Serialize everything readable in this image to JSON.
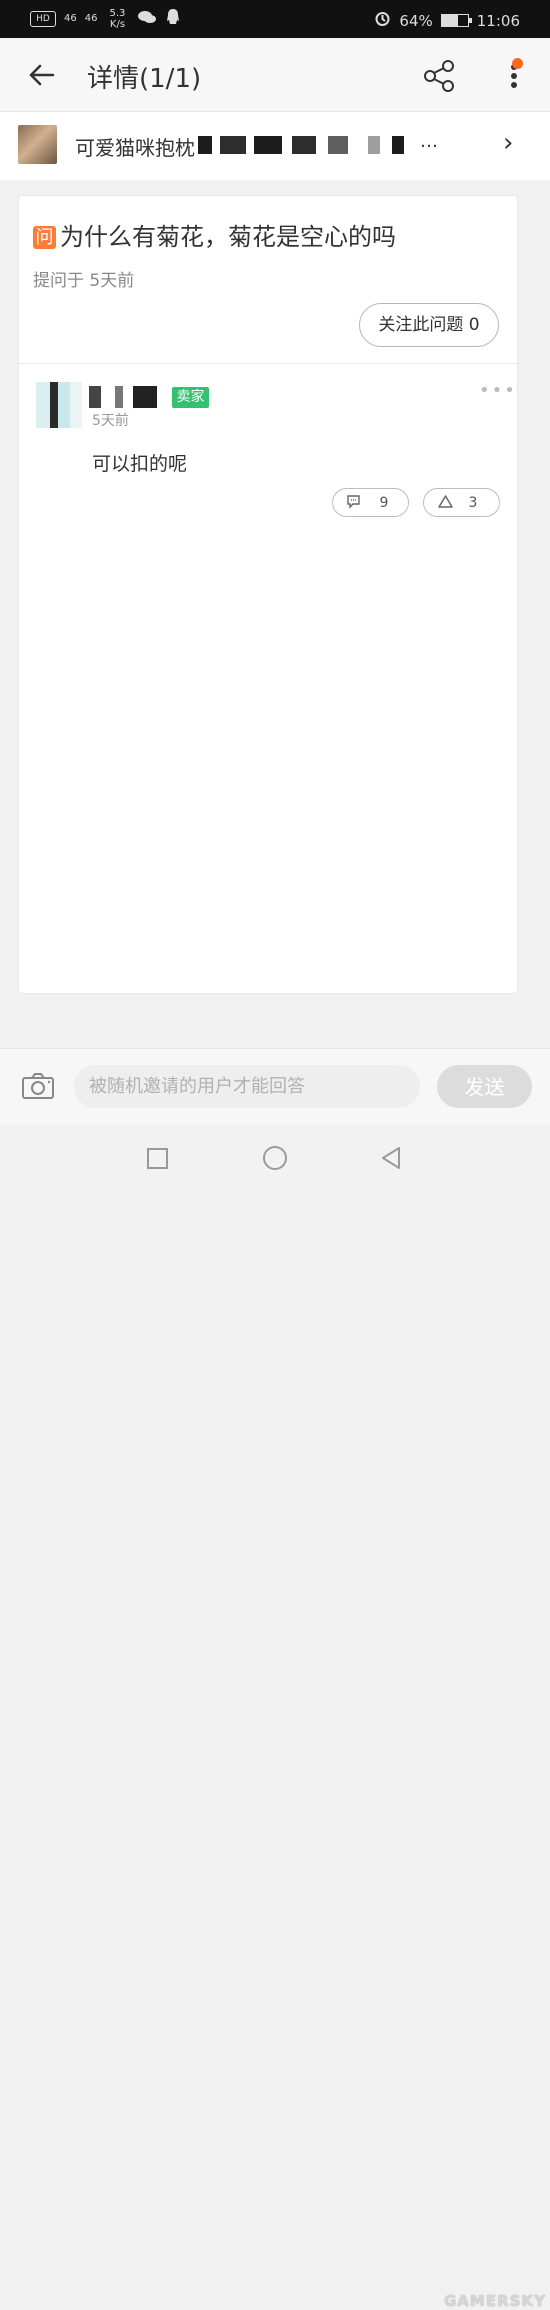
{
  "status_bar": {
    "hd": "HD",
    "signal_1": "46",
    "signal_2": "46",
    "speed_value": "5.3",
    "speed_unit": "K/s",
    "battery": "64%",
    "time": "11:06",
    "battery_level": 0.64,
    "icons": [
      "wechat-icon",
      "qq-icon",
      "alarm-icon",
      "battery-icon"
    ]
  },
  "header": {
    "title": "详情(1/1)",
    "icons": [
      "back-arrow-icon",
      "share-icon",
      "more-vertical-icon"
    ],
    "notification_color": "#ff6a1a"
  },
  "product": {
    "name": "可爱猫咪抱枕",
    "ellipsis": "…",
    "chevron": "›"
  },
  "question": {
    "badge": "问",
    "title": "为什么有菊花，菊花是空心的吗",
    "asked": "提问于  5天前",
    "follow_label": "关注此问题 0",
    "badge_color": "#ff7b38"
  },
  "answer": {
    "seller_badge": "卖家",
    "time": "5天前",
    "text": "可以扣的呢",
    "comment_count": "9",
    "upvote_count": "3",
    "seller_color": "#34c16f"
  },
  "bottom_bar": {
    "placeholder": "被随机邀请的用户才能回答",
    "send_label": "发送"
  },
  "watermark": "GAMERSKY"
}
